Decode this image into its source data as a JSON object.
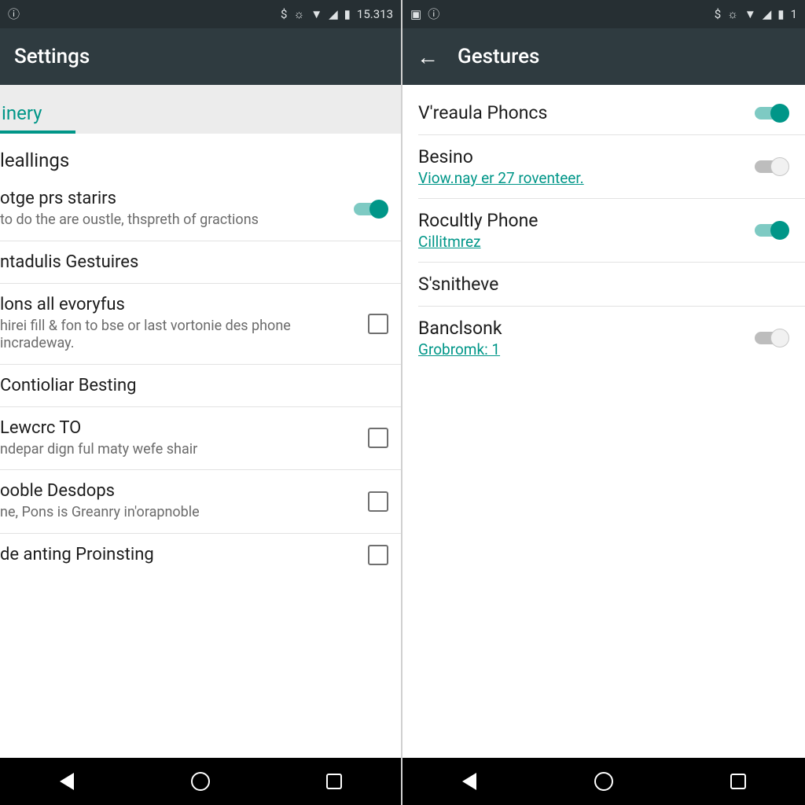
{
  "colors": {
    "accent": "#009688",
    "appbar": "#2f3b40",
    "statusbar": "#262f33"
  },
  "left": {
    "statusbar": {
      "left_icons": [
        "info"
      ],
      "right_icons": [
        "currency",
        "alarm",
        "wifi",
        "signal",
        "battery"
      ],
      "time": "15.313"
    },
    "appbar": {
      "title": "Settings",
      "has_back": false
    },
    "tabs": [
      {
        "label": "inery",
        "active": true
      }
    ],
    "sections": [
      {
        "header": "leallings"
      }
    ],
    "items": [
      {
        "title": "otge prs starirs",
        "sub": "to do the are oustle, thspreth of gractions",
        "control": "switch",
        "state": "on"
      },
      {
        "title": "ntadulis Gestuires",
        "sub": "",
        "control": "none",
        "state": ""
      },
      {
        "title": "lons all evoryfus",
        "sub": "hirei fill & fon to bse or last vortonie des phone incradeway.",
        "control": "checkbox",
        "state": "off"
      },
      {
        "title": "Contioliar Besting",
        "sub": "",
        "control": "none",
        "state": ""
      },
      {
        "title": "Lewcrc TO",
        "sub": "ndepar dign ful maty wefe shair",
        "control": "checkbox",
        "state": "off"
      },
      {
        "title": "ooble Desdops",
        "sub": "ne, Pons is Greanry in'orapnoble",
        "control": "checkbox",
        "state": "off"
      },
      {
        "title": "de anting Proinsting",
        "sub": "",
        "control": "checkbox",
        "state": "off"
      }
    ]
  },
  "right": {
    "statusbar": {
      "left_icons": [
        "screenshot",
        "info"
      ],
      "right_icons": [
        "currency",
        "alarm",
        "wifi",
        "signal",
        "battery"
      ],
      "time": "1"
    },
    "appbar": {
      "title": "Gestures",
      "has_back": true
    },
    "items": [
      {
        "title": "V'reaula Phoncs",
        "link": "",
        "control": "switch",
        "state": "on"
      },
      {
        "title": "Besino",
        "link": "Viow.nay er 27 roventeer.",
        "control": "switch",
        "state": "off"
      },
      {
        "title": "Rocultly Phone",
        "link": "Cillitmrez",
        "control": "switch",
        "state": "on"
      },
      {
        "title": "S'snitheve",
        "link": "",
        "control": "none",
        "state": ""
      },
      {
        "title": "Banclsonk",
        "link": "Grobromk: 1",
        "control": "switch",
        "state": "off"
      }
    ]
  },
  "icon_glyphs": {
    "info": "ⓘ",
    "screenshot": "▣",
    "currency": "$",
    "alarm": "⏰",
    "wifi": "▾",
    "signal": "◢",
    "battery": "▮"
  }
}
